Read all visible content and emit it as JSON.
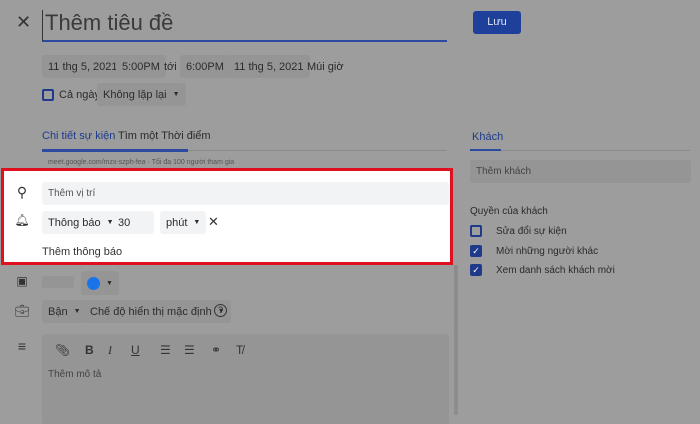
{
  "header": {
    "title_placeholder": "Thêm tiêu đề",
    "save_label": "Lưu"
  },
  "datetime": {
    "start_date": "11 thg 5, 2021",
    "start_time": "5:00PM",
    "to": "tới",
    "end_time": "6:00PM",
    "end_date": "11 thg 5, 2021",
    "timezone": "Múi giờ"
  },
  "options": {
    "all_day": "Cả ngày",
    "all_day_checked": false,
    "repeat": "Không lặp lại"
  },
  "tabs": [
    {
      "label": "Chi tiết sự kiện",
      "active": true
    },
    {
      "label": "Tìm một Thời điểm",
      "active": false
    }
  ],
  "meet": "meet.google.com/mzx-szph-fea · Tối đa 100 người tham gia",
  "location_placeholder": "Thêm vị trí",
  "notification": {
    "type": "Thông báo",
    "value": "30",
    "unit": "phút",
    "add": "Thêm thông báo"
  },
  "calendar": {
    "color": "#1a73e8"
  },
  "availability": {
    "status": "Bận",
    "visibility": "Chế độ hiển thị mặc định"
  },
  "description_placeholder": "Thêm mô tả",
  "guests": {
    "tab": "Khách",
    "placeholder": "Thêm khách",
    "permissions_title": "Quyền của khách",
    "permissions": [
      {
        "label": "Sửa đổi sự kiện",
        "checked": false
      },
      {
        "label": "Mời những người khác",
        "checked": true
      },
      {
        "label": "Xem danh sách khách mời",
        "checked": true
      }
    ]
  },
  "colors": {
    "accent": "#1f3a8a",
    "highlight": "#e0101e"
  }
}
